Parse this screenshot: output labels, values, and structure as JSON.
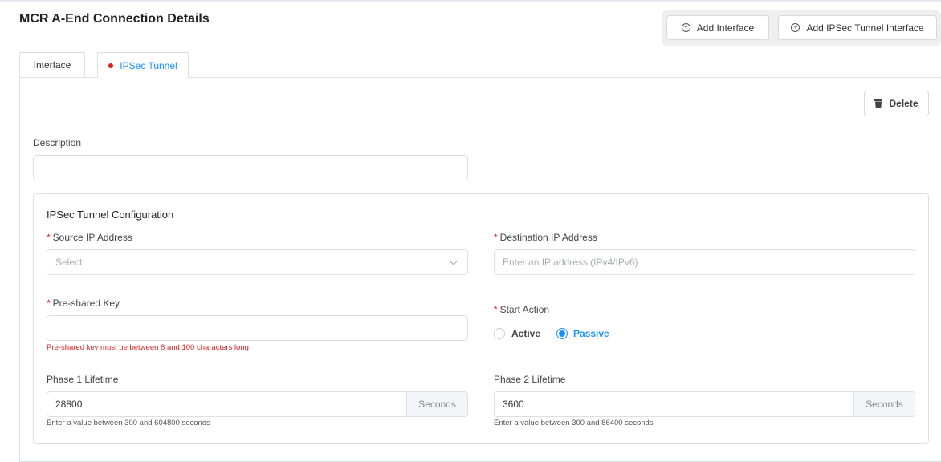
{
  "header": {
    "title": "MCR A-End Connection Details",
    "add_interface": "Add Interface",
    "add_ipsec": "Add IPSec Tunnel Interface"
  },
  "tabs": [
    {
      "label": "Interface",
      "active": false
    },
    {
      "label": "IPSec Tunnel",
      "active": true,
      "error_dot": true
    }
  ],
  "actions": {
    "delete": "Delete"
  },
  "description": {
    "label": "Description",
    "value": ""
  },
  "config": {
    "title": "IPSec Tunnel Configuration",
    "source_ip": {
      "label": "Source IP Address",
      "placeholder": "Select"
    },
    "dest_ip": {
      "label": "Destination IP Address",
      "placeholder": "Enter an IP address (IPv4/IPv6)"
    },
    "psk": {
      "label": "Pre-shared Key",
      "value": "",
      "error": "Pre-shared key must be between 8 and 100 characters long"
    },
    "start_action": {
      "label": "Start Action",
      "options": [
        "Active",
        "Passive"
      ],
      "selected": "Passive"
    },
    "phase1": {
      "label": "Phase 1 Lifetime",
      "value": "28800",
      "unit": "Seconds",
      "hint": "Enter a value between 300 and 604800 seconds"
    },
    "phase2": {
      "label": "Phase 2 Lifetime",
      "value": "3600",
      "unit": "Seconds",
      "hint": "Enter a value between 300 and 86400 seconds"
    }
  },
  "colors": {
    "accent": "#1890ff",
    "error": "#e02020"
  }
}
